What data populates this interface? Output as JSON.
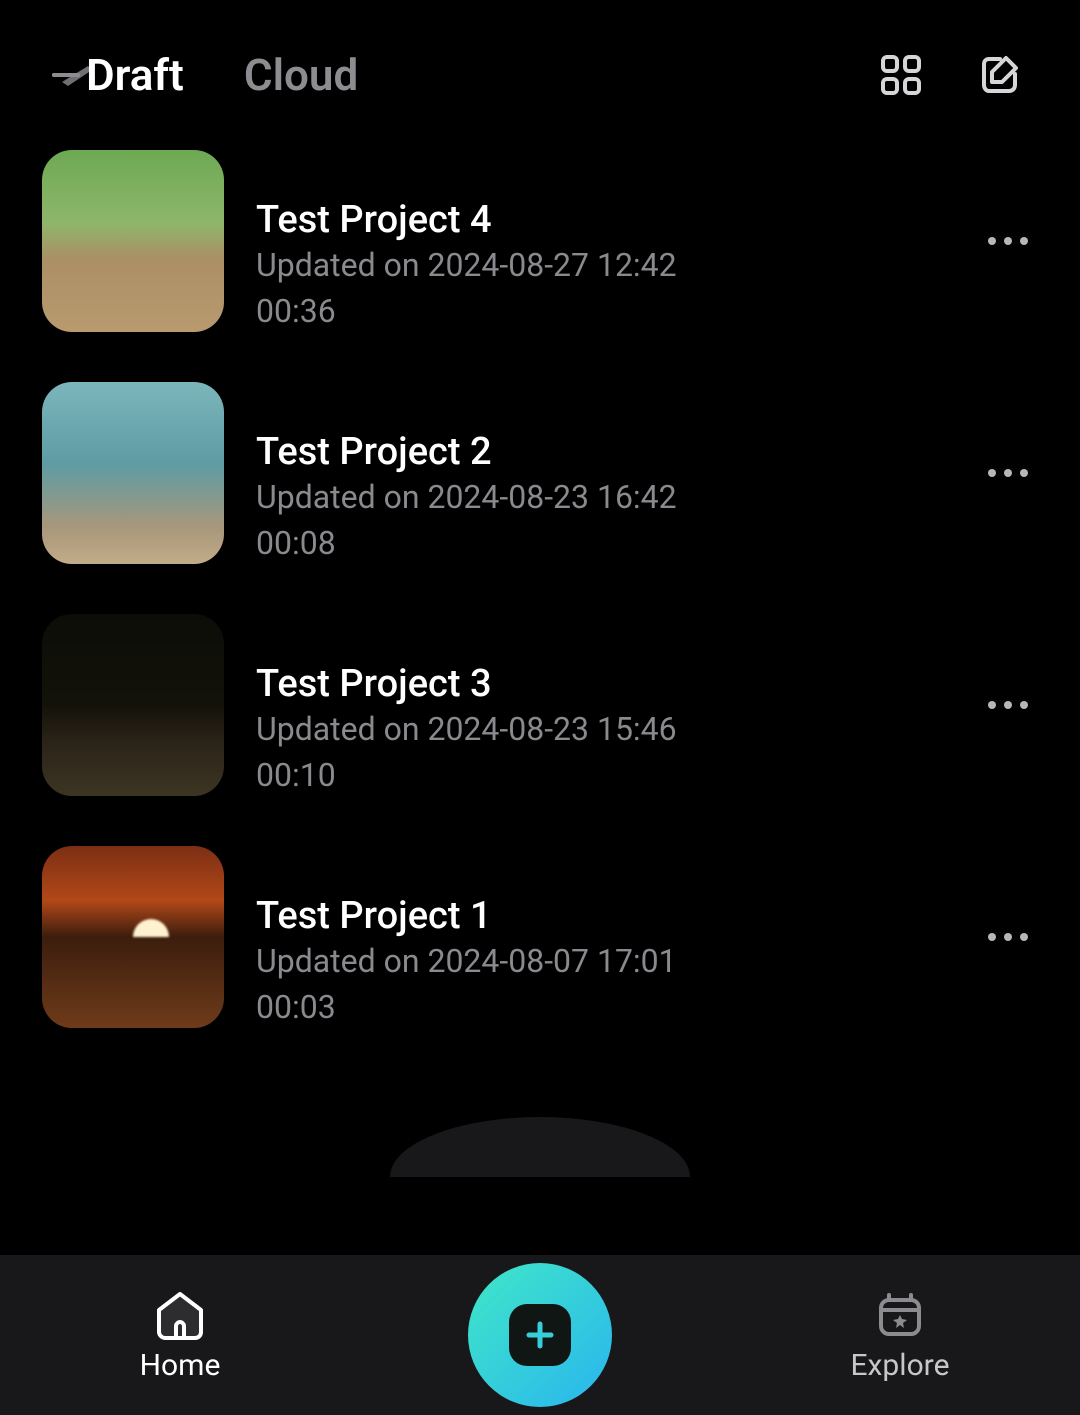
{
  "header": {
    "tabs": [
      {
        "label": "Draft",
        "active": true
      },
      {
        "label": "Cloud",
        "active": false
      }
    ],
    "grid_icon": "grid-icon",
    "compose_icon": "compose-icon"
  },
  "projects": [
    {
      "title": "Test Project 4",
      "updated": "Updated on 2024-08-27 12:42",
      "duration": "00:36",
      "thumb": "park"
    },
    {
      "title": "Test Project 2",
      "updated": "Updated on 2024-08-23 16:42",
      "duration": "00:08",
      "thumb": "sea"
    },
    {
      "title": "Test Project 3",
      "updated": "Updated on 2024-08-23 15:46",
      "duration": "00:10",
      "thumb": "night"
    },
    {
      "title": "Test Project 1",
      "updated": "Updated on 2024-08-07 17:01",
      "duration": "00:03",
      "thumb": "sunset"
    }
  ],
  "bottom_nav": {
    "home_label": "Home",
    "explore_label": "Explore",
    "fab_icon": "plus-icon"
  }
}
